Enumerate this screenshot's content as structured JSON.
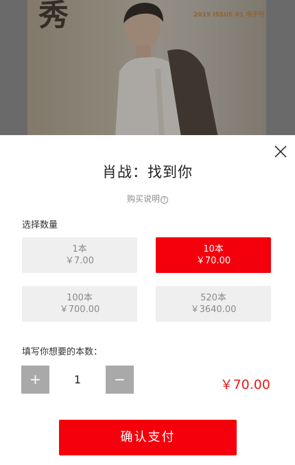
{
  "cover": {
    "title_left": "秀",
    "title_right": " ",
    "issue_text": "2019 ISSUE 01  电子刊"
  },
  "sheet": {
    "title": "肖战：找到你",
    "help_label": "购买说明",
    "help_icon": "?",
    "select_qty_label": "选择数量",
    "options": [
      {
        "count": "1本",
        "price": "￥7.00",
        "selected": false
      },
      {
        "count": "10本",
        "price": "￥70.00",
        "selected": true
      },
      {
        "count": "100本",
        "price": "￥700.00",
        "selected": false
      },
      {
        "count": "520本",
        "price": "￥3640.00",
        "selected": false
      }
    ],
    "custom_qty_label": "填写你想要的本数：",
    "stepper": {
      "plus": "+",
      "minus": "−",
      "value": "1"
    },
    "total": "￥70.00",
    "confirm_label": "确认支付"
  },
  "colors": {
    "accent": "#f4000c",
    "price": "#ea1a1a",
    "option_bg": "#efefef",
    "stepper_bg": "#a9a9a9"
  }
}
